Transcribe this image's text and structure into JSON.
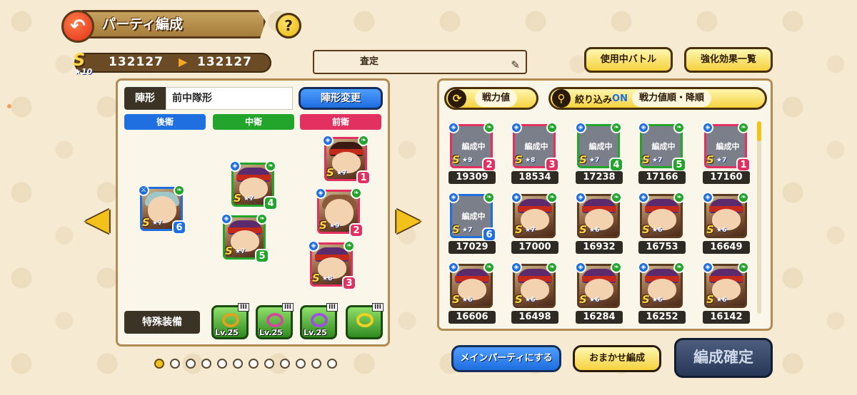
{
  "header": {
    "title": "パーティ編成",
    "help_label": "?",
    "score": {
      "rank": "S",
      "rank_stars": "★10",
      "current": "132127",
      "next": "132127"
    },
    "party_name_label": "査定",
    "buttons": {
      "battle_in_use": "使用中バトル",
      "boost_list": "強化効果一覧"
    }
  },
  "formation": {
    "label": "陣形",
    "value": "前中隊形",
    "change_button": "陣形変更",
    "tabs": {
      "back": "後衛",
      "middle": "中衛",
      "front": "前衛"
    },
    "colors": {
      "back": "#1f6fe0",
      "middle": "#22a52a",
      "front": "#e23060"
    },
    "members": [
      {
        "slot": "6",
        "stars": "★7",
        "rank": "S"
      },
      {
        "slot": "4",
        "stars": "★7",
        "rank": "S"
      },
      {
        "slot": "5",
        "stars": "★7",
        "rank": "S"
      },
      {
        "slot": "1",
        "stars": "★7",
        "rank": "S"
      },
      {
        "slot": "2",
        "stars": "★9",
        "rank": "S"
      },
      {
        "slot": "3",
        "stars": "★8",
        "rank": "S"
      }
    ]
  },
  "special_equipment": {
    "label": "特殊装備",
    "items": [
      {
        "grade": "III",
        "level": "Lv.25"
      },
      {
        "grade": "III",
        "level": "Lv.25"
      },
      {
        "grade": "III",
        "level": "Lv.25"
      },
      {
        "grade": "III",
        "level": ""
      }
    ]
  },
  "sort": {
    "power_label": "戦力値",
    "filter_label": "絞り込み",
    "filter_state": "ON",
    "sort_order": "戦力値順・降順"
  },
  "roster": {
    "in_party_label": "編成中",
    "rows": [
      [
        {
          "power": "19309",
          "stars": "★9",
          "slot": "2",
          "in_party": true
        },
        {
          "power": "18534",
          "stars": "★8",
          "slot": "3",
          "in_party": true
        },
        {
          "power": "17238",
          "stars": "★7",
          "slot": "4",
          "in_party": true
        },
        {
          "power": "17166",
          "stars": "★7",
          "slot": "5",
          "in_party": true
        },
        {
          "power": "17160",
          "stars": "★7",
          "slot": "1",
          "in_party": true
        }
      ],
      [
        {
          "power": "17029",
          "stars": "★7",
          "slot": "6",
          "in_party": true
        },
        {
          "power": "17000",
          "stars": "★7",
          "slot": "",
          "in_party": false
        },
        {
          "power": "16932",
          "stars": "★6",
          "slot": "",
          "in_party": false
        },
        {
          "power": "16753",
          "stars": "★6",
          "slot": "",
          "in_party": false
        },
        {
          "power": "16649",
          "stars": "★6",
          "slot": "",
          "in_party": false
        }
      ],
      [
        {
          "power": "16606",
          "stars": "★6",
          "slot": "",
          "in_party": false
        },
        {
          "power": "16498",
          "stars": "★6",
          "slot": "",
          "in_party": false
        },
        {
          "power": "16284",
          "stars": "★6",
          "slot": "",
          "in_party": false
        },
        {
          "power": "16252",
          "stars": "★6",
          "slot": "",
          "in_party": false
        },
        {
          "power": "16142",
          "stars": "★6",
          "slot": "",
          "in_party": false
        }
      ]
    ]
  },
  "footer": {
    "main_party_button": "メインパーティにする",
    "auto_button": "おまかせ編成",
    "confirm_button": "編成確定",
    "page_count": 12,
    "active_page": 1
  }
}
